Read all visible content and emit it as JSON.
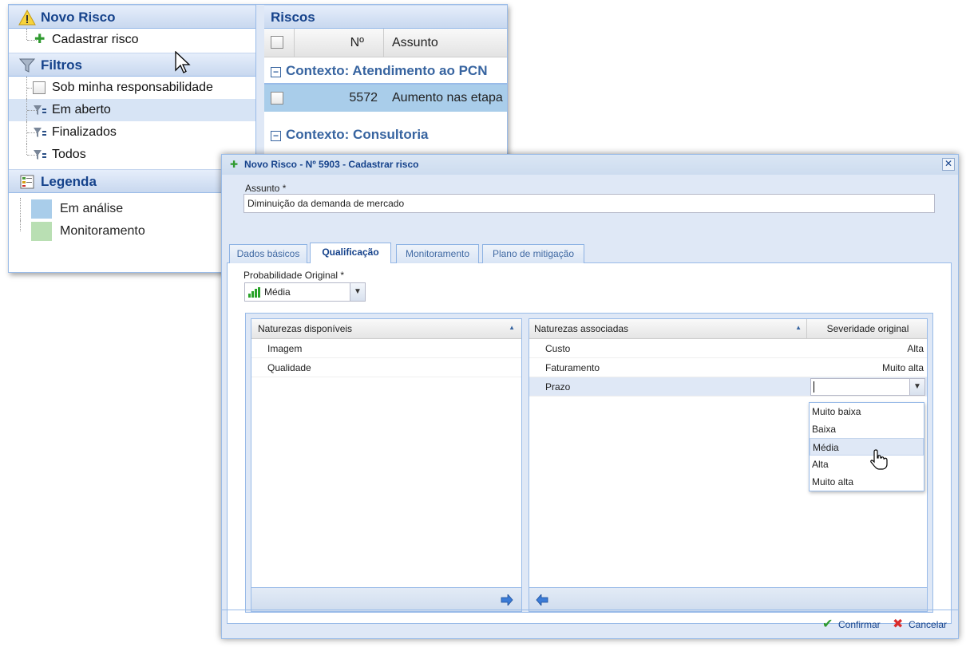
{
  "left": {
    "novo_risco": {
      "title": "Novo Risco",
      "item": "Cadastrar risco"
    },
    "filtros": {
      "title": "Filtros",
      "items": [
        "Sob minha responsabilidade",
        "Em aberto",
        "Finalizados",
        "Todos"
      ]
    },
    "legenda": {
      "title": "Legenda",
      "items": [
        {
          "label": "Em análise",
          "color": "#a9cdea"
        },
        {
          "label": "Monitoramento",
          "color": "#b9dfb3"
        }
      ]
    }
  },
  "riscos": {
    "title": "Riscos",
    "columns": {
      "num": "Nº",
      "assunto": "Assunto"
    },
    "group1": "Contexto: Atendimento ao PCN",
    "row1": {
      "num": "5572",
      "assunto": "Aumento nas etapa"
    },
    "group2": "Contexto: Consultoria"
  },
  "dialog": {
    "title": "Novo Risco - Nº 5903 - Cadastrar risco",
    "assunto_label": "Assunto *",
    "assunto_value": "Diminuição da demanda de mercado",
    "tabs": [
      "Dados básicos",
      "Qualificação",
      "Monitoramento",
      "Plano de mitigação"
    ],
    "prob_label": "Probabilidade Original *",
    "prob_value": "Média",
    "disponiveis": {
      "header": "Naturezas disponíveis",
      "items": [
        "Imagem",
        "Qualidade"
      ]
    },
    "associadas": {
      "header": "Naturezas associadas",
      "sev_header": "Severidade original",
      "rows": [
        {
          "name": "Custo",
          "sev": "Alta"
        },
        {
          "name": "Faturamento",
          "sev": "Muito alta"
        },
        {
          "name": "Prazo",
          "sev": ""
        }
      ]
    },
    "dropdown_options": [
      "Muito baixa",
      "Baixa",
      "Média",
      "Alta",
      "Muito alta"
    ],
    "confirm": "Confirmar",
    "cancel": "Cancelar"
  },
  "colors": {
    "accent": "#15428b",
    "panel_bg": "#dfe8f6",
    "border": "#99bbe8",
    "selected_row": "#a9cdea"
  }
}
